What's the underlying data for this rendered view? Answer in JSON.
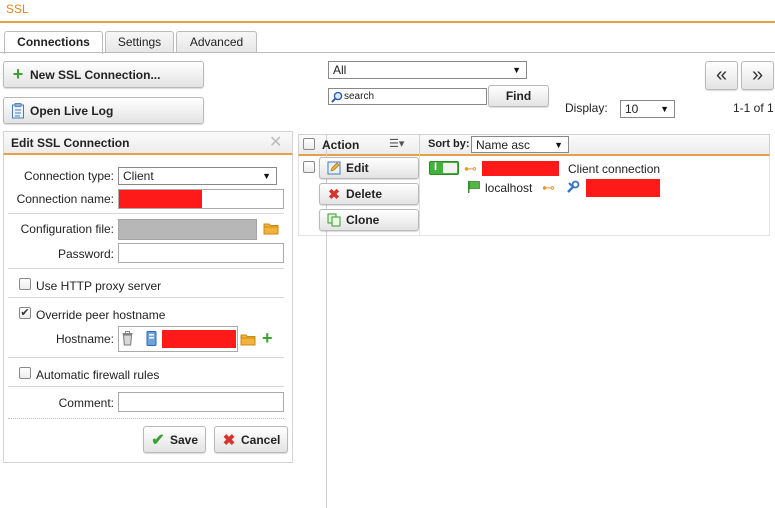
{
  "page": {
    "title": "SSL"
  },
  "tabs": [
    {
      "label": "Connections",
      "active": true
    },
    {
      "label": "Settings",
      "active": false
    },
    {
      "label": "Advanced",
      "active": false
    }
  ],
  "toolbar": {
    "new_connection_label": "New SSL Connection...",
    "open_live_log_label": "Open Live Log",
    "filter_value": "All",
    "search_placeholder": "search",
    "find_label": "Find",
    "display_label": "Display:",
    "display_value": "10",
    "pagination_text": "1-1 of 1",
    "prev_label": "«",
    "next_label": "»"
  },
  "edit_panel": {
    "title": "Edit SSL Connection",
    "connection_type_label": "Connection type:",
    "connection_type_value": "Client",
    "connection_name_label": "Connection name:",
    "configuration_file_label": "Configuration file:",
    "password_label": "Password:",
    "use_http_proxy_label": "Use HTTP proxy server",
    "use_http_proxy_checked": false,
    "override_peer_label": "Override peer hostname",
    "override_peer_checked": true,
    "hostname_label": "Hostname:",
    "firewall_rules_label": "Automatic firewall rules",
    "firewall_rules_checked": false,
    "comment_label": "Comment:",
    "save_label": "Save",
    "cancel_label": "Cancel"
  },
  "grid": {
    "action_header": "Action",
    "sort_by_label": "Sort by:",
    "sort_value": "Name asc",
    "rows": [
      {
        "edit_label": "Edit",
        "delete_label": "Delete",
        "clone_label": "Clone",
        "toggle_label": "I",
        "enabled": true,
        "description": "Client connection",
        "host": "localhost"
      }
    ]
  },
  "colors": {
    "accent": "#e7a04a",
    "title": "#e0861e",
    "redaction": "#ff1a1a",
    "enabled_green": "#41b23a"
  }
}
